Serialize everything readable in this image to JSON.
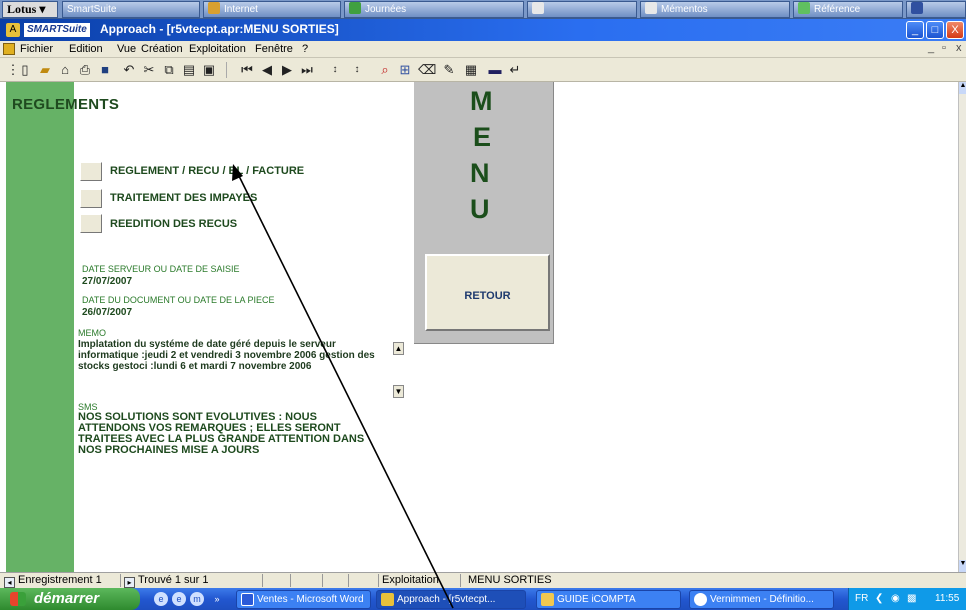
{
  "suite": {
    "lotus": "Lotus",
    "items": [
      "SmartSuite",
      "Internet",
      "Journées",
      "Mémentos",
      "Référence"
    ]
  },
  "window": {
    "brand": "SMARTSuite",
    "title": "Approach - [r5vtecpt.apr:MENU SORTIES]",
    "min": "_",
    "max": "□",
    "close": "X"
  },
  "menu": [
    "Fichier",
    "Edition",
    "Vue",
    "Création",
    "Exploitation",
    "Fenêtre",
    "?"
  ],
  "page": {
    "heading": "REGLEMENTS",
    "options": [
      "REGLEMENT / RECU / BL / FACTURE",
      "TRAITEMENT DES  IMPAYES",
      "REEDITION DES RECUS"
    ],
    "date_server_label": "DATE SERVEUR OU DATE DE SAISIE",
    "date_server_value": "27/07/2007",
    "date_doc_label": "DATE DU DOCUMENT OU DATE DE LA PIECE",
    "date_doc_value": "26/07/2007",
    "memo_label": "MEMO",
    "memo_text": "Implatation du systéme de date géré depuis le serveur informatique :jeudi 2 et vendredi 3 novembre 2006 gestion des stocks gestoci :lundi  6 et mardi 7 novembre 2006",
    "sms_label": "SMS",
    "sms_text": "NOS SOLUTIONS SONT EVOLUTIVES : NOUS ATTENDONS VOS REMARQUES ; ELLES SERONT TRAITEES AVEC LA PLUS GRANDE ATTENTION DANS NOS PROCHAINES MISE A JOURS",
    "menu_letters": [
      "M",
      "E",
      "N",
      "U"
    ],
    "retour": "RETOUR"
  },
  "status": {
    "record": "Enregistrement 1",
    "found": "Trouvé 1 sur 1",
    "mode": "Exploitation",
    "view": "MENU SORTIES"
  },
  "taskbar": {
    "start": "démarrer",
    "tasks": [
      "Ventes - Microsoft Word",
      "Approach - [r5vtecpt...",
      "GUIDE iCOMPTA",
      "Vernimmen - Définitio..."
    ],
    "lang": "FR",
    "clock": "11:55"
  }
}
